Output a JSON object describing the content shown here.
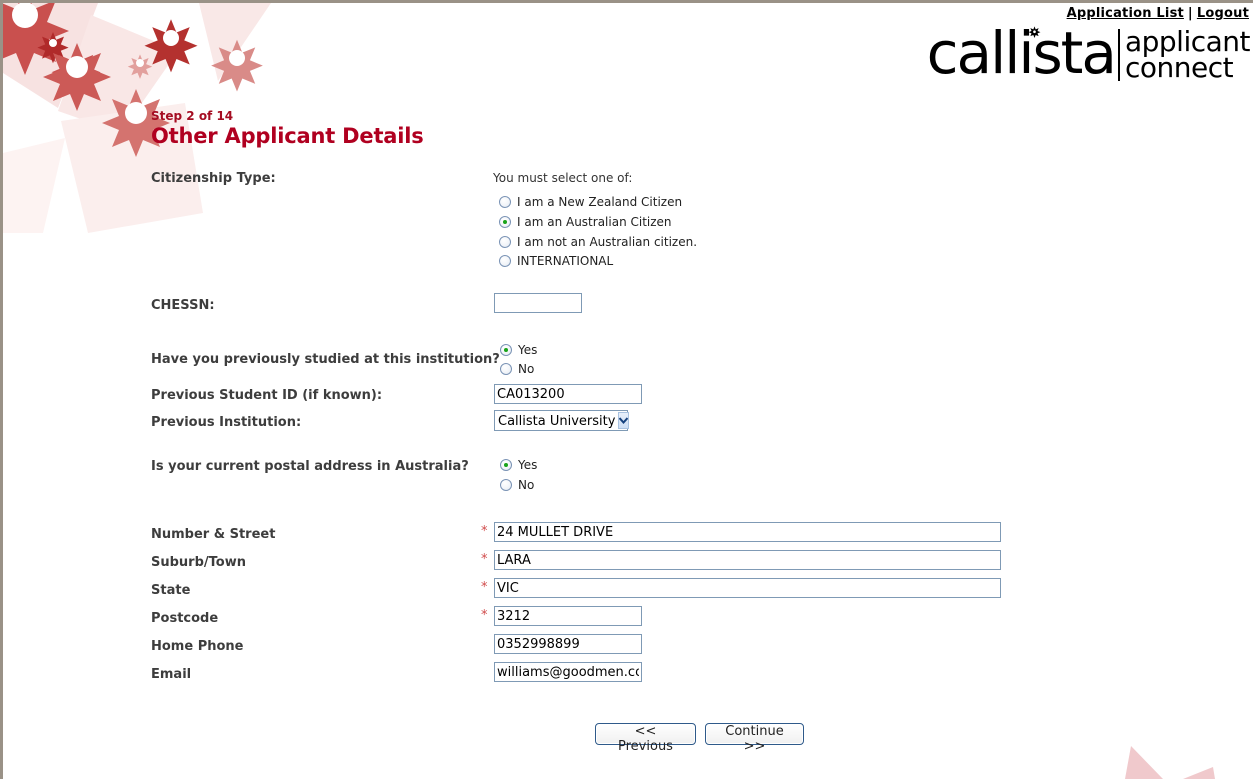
{
  "top_links": {
    "application_list": "Application List",
    "separator": "|",
    "logout": "Logout"
  },
  "brand": {
    "primary": "callista",
    "line1": "applicant",
    "line2": "connect"
  },
  "header": {
    "step": "Step 2 of 14",
    "title": "Other Applicant Details"
  },
  "colors": {
    "title_red": "#b00020",
    "step_red": "#a50d22",
    "label_grey": "#3d3d3d",
    "required_red": "#d04a4a",
    "field_border": "#7f9ab5",
    "radio_dot_green": "#19a319",
    "deco_star_dark": "#b02a2a",
    "deco_star_mid": "#d4736f",
    "deco_shard_pale": "#f6dedd"
  },
  "form": {
    "citizenship": {
      "label": "Citizenship Type:",
      "instruction": "You must select one of:",
      "options": [
        {
          "label": "I am a New Zealand Citizen",
          "selected": false
        },
        {
          "label": "I am an Australian Citizen",
          "selected": true
        },
        {
          "label": "I am not an Australian citizen.",
          "selected": false
        },
        {
          "label": "INTERNATIONAL",
          "selected": false
        }
      ]
    },
    "chessn": {
      "label": "CHESSN:",
      "value": "",
      "placeholder": ""
    },
    "previously_studied": {
      "label": "Have you previously studied at this institution?",
      "options": [
        {
          "label": "Yes",
          "selected": true
        },
        {
          "label": "No",
          "selected": false
        }
      ]
    },
    "previous_student_id": {
      "label": "Previous Student ID (if known):",
      "value": "CA013200"
    },
    "previous_institution": {
      "label": "Previous Institution:",
      "value": "Callista University",
      "options": [
        "Callista University"
      ]
    },
    "postal_in_australia": {
      "label": "Is your current postal address in Australia?",
      "options": [
        {
          "label": "Yes",
          "selected": true
        },
        {
          "label": "No",
          "selected": false
        }
      ]
    },
    "address_fields": [
      {
        "label": "Number & Street",
        "value": "24 MULLET DRIVE",
        "required": true
      },
      {
        "label": "Suburb/Town",
        "value": "LARA",
        "required": true
      },
      {
        "label": "State",
        "value": "VIC",
        "required": true
      },
      {
        "label": "Postcode",
        "value": "3212",
        "required": true
      },
      {
        "label": "Home Phone",
        "value": "0352998899",
        "required": false
      },
      {
        "label": "Email",
        "value": "williams@goodmen.com",
        "required": false
      }
    ],
    "required_marker": "*"
  },
  "buttons": {
    "previous": "<< Previous",
    "continue": "Continue >>"
  }
}
